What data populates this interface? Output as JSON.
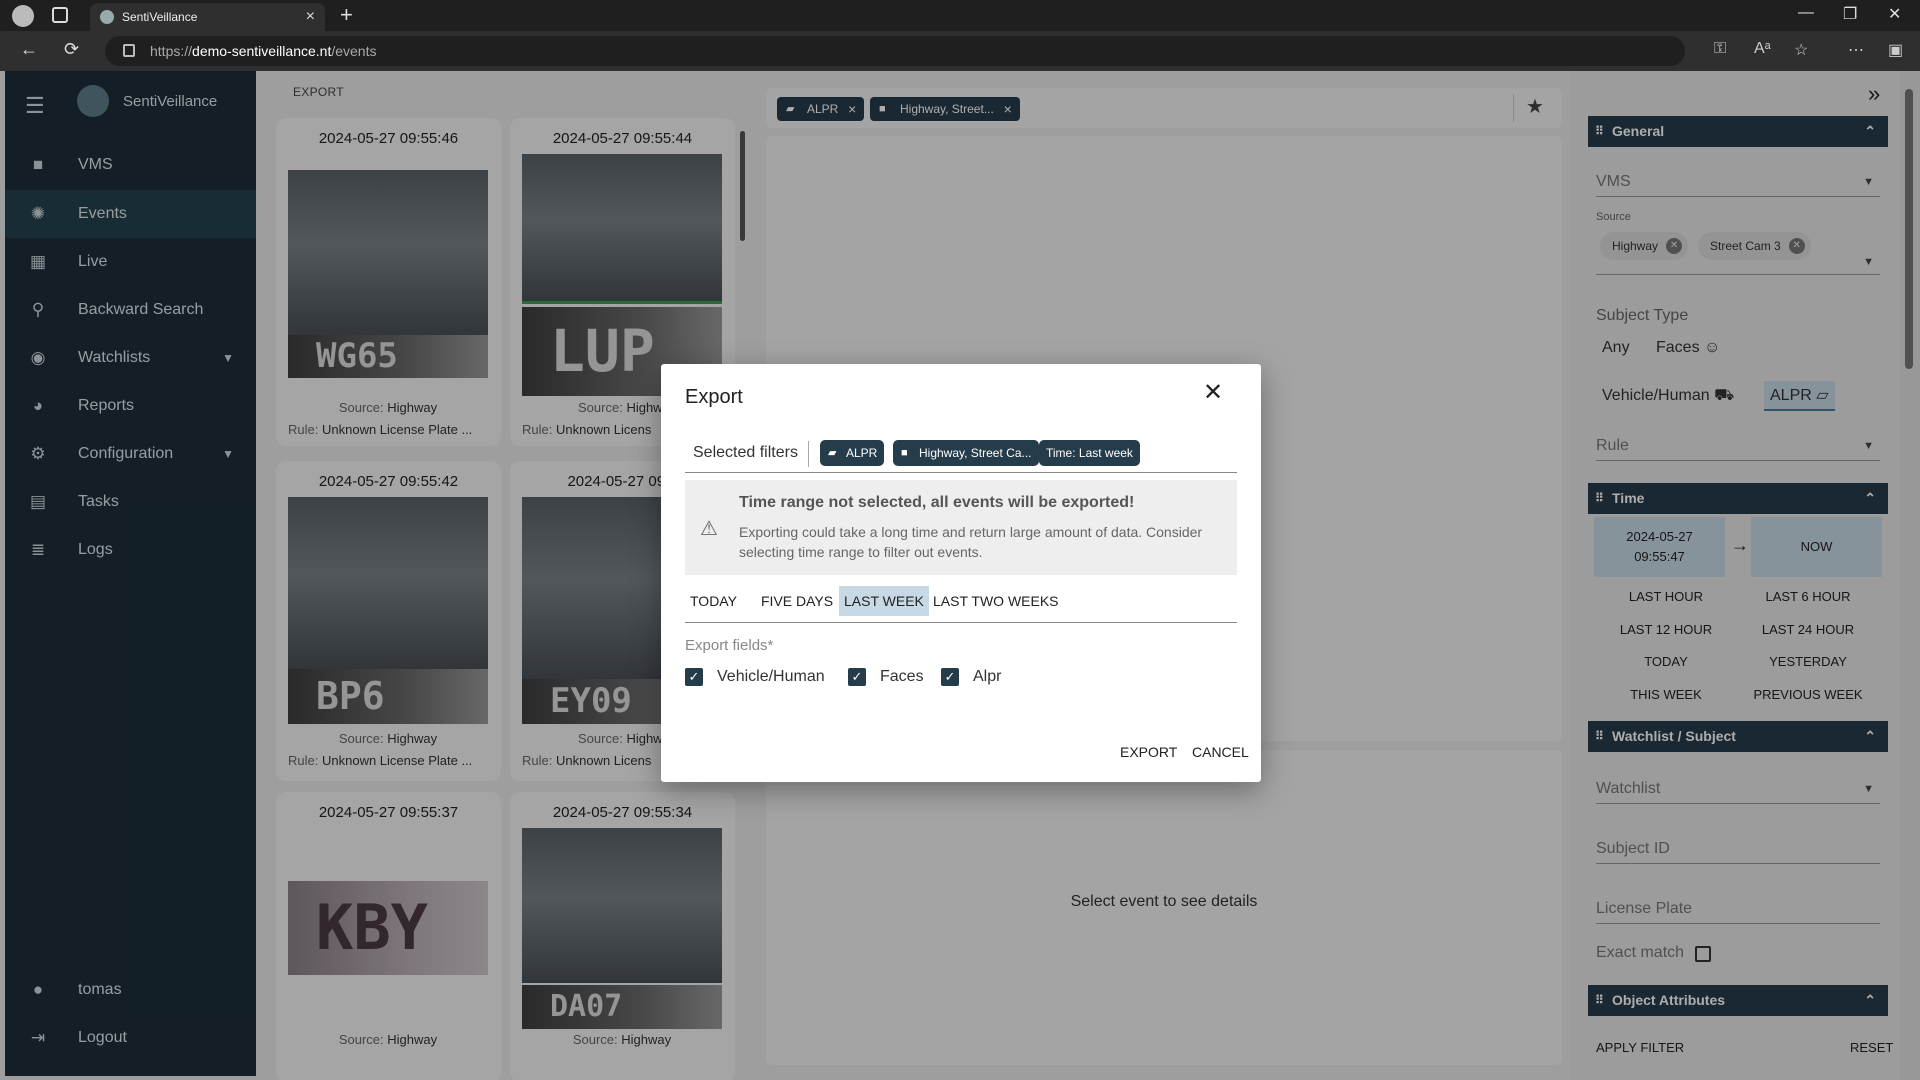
{
  "browser": {
    "tab_title": "SentiVeillance",
    "url_scheme": "https://",
    "url_host": "demo-sentiveillance.nt",
    "url_path": "/events"
  },
  "sidebar": {
    "app_name": "SentiVeillance",
    "items": [
      {
        "label": "VMS",
        "icon": "camera-icon"
      },
      {
        "label": "Events",
        "icon": "aperture-icon"
      },
      {
        "label": "Live",
        "icon": "grid-icon"
      },
      {
        "label": "Backward Search",
        "icon": "search-icon"
      },
      {
        "label": "Watchlists",
        "icon": "eye-icon"
      },
      {
        "label": "Reports",
        "icon": "pie-chart-icon"
      },
      {
        "label": "Configuration",
        "icon": "gear-icon"
      },
      {
        "label": "Tasks",
        "icon": "clipboard-icon"
      },
      {
        "label": "Logs",
        "icon": "list-icon"
      }
    ],
    "user": "tomas",
    "logout": "Logout"
  },
  "events": {
    "title": "EXPORT",
    "cards": [
      {
        "time": "2024-05-27 09:55:46",
        "plate": "WG65",
        "source_label": "Source:",
        "source": "Highway",
        "rule_label": "Rule:",
        "rule": "Unknown License Plate ..."
      },
      {
        "time": "2024-05-27 09:55:44",
        "plate": "LUP",
        "source_label": "Source:",
        "source": "Highw",
        "rule_label": "Rule:",
        "rule": "Unknown Licens"
      },
      {
        "time": "2024-05-27 09:55:42",
        "plate": "BP6",
        "source_label": "Source:",
        "source": "Highway",
        "rule_label": "Rule:",
        "rule": "Unknown License Plate ..."
      },
      {
        "time": "2024-05-27 09:5",
        "plate": "EY09",
        "source_label": "Source:",
        "source": "Highw",
        "rule_label": "Rule:",
        "rule": "Unknown Licens"
      },
      {
        "time": "2024-05-27 09:55:37",
        "plate": "KBY",
        "source_label": "Source:",
        "source": "Highway"
      },
      {
        "time": "2024-05-27 09:55:34",
        "plate": "DA07",
        "source_label": "Source:",
        "source": "Highway"
      }
    ]
  },
  "middle": {
    "chips": [
      {
        "label": "ALPR",
        "icon": "alpr-icon"
      },
      {
        "label": "Highway, Street...",
        "icon": "video-camera-icon"
      }
    ],
    "details_message": "Select event to see details"
  },
  "right_panel": {
    "general": {
      "title": "General",
      "vms_placeholder": "VMS",
      "source_label": "Source",
      "sources": [
        "Highway",
        "Street Cam 3"
      ],
      "subject_type_label": "Subject Type",
      "subject_types": [
        "Any",
        "Faces",
        "Vehicle/Human",
        "ALPR"
      ],
      "rule_placeholder": "Rule"
    },
    "time": {
      "title": "Time",
      "from_date": "2024-05-27",
      "from_time": "09:55:47",
      "to": "NOW",
      "presets": [
        "LAST HOUR",
        "LAST 6 HOUR",
        "LAST 12 HOUR",
        "LAST 24 HOUR",
        "TODAY",
        "YESTERDAY",
        "THIS WEEK",
        "PREVIOUS WEEK"
      ]
    },
    "watchlist": {
      "title": "Watchlist / Subject",
      "watchlist_placeholder": "Watchlist",
      "subject_id_placeholder": "Subject ID",
      "license_plate_placeholder": "License Plate",
      "exact_match_label": "Exact match"
    },
    "object_attributes": {
      "title": "Object Attributes"
    },
    "apply_label": "APPLY FILTER",
    "reset_label": "RESET"
  },
  "modal": {
    "title": "Export",
    "selected_filters_label": "Selected filters",
    "filter_chips": [
      {
        "label": "ALPR",
        "icon": "alpr-icon"
      },
      {
        "label": "Highway, Street Ca...",
        "icon": "video-camera-icon"
      },
      {
        "label": "Time: Last week"
      }
    ],
    "warning_title": "Time range not selected, all events will be exported!",
    "warning_text": "Exporting could take a long time and return large amount of data. Consider selecting time range to filter out events.",
    "time_ranges": [
      "TODAY",
      "FIVE DAYS",
      "LAST WEEK",
      "LAST TWO WEEKS"
    ],
    "selected_time_range": "LAST WEEK",
    "export_fields_label": "Export fields*",
    "fields": [
      {
        "label": "Vehicle/Human",
        "checked": true
      },
      {
        "label": "Faces",
        "checked": true
      },
      {
        "label": "Alpr",
        "checked": true
      }
    ],
    "export_label": "EXPORT",
    "cancel_label": "CANCEL"
  }
}
